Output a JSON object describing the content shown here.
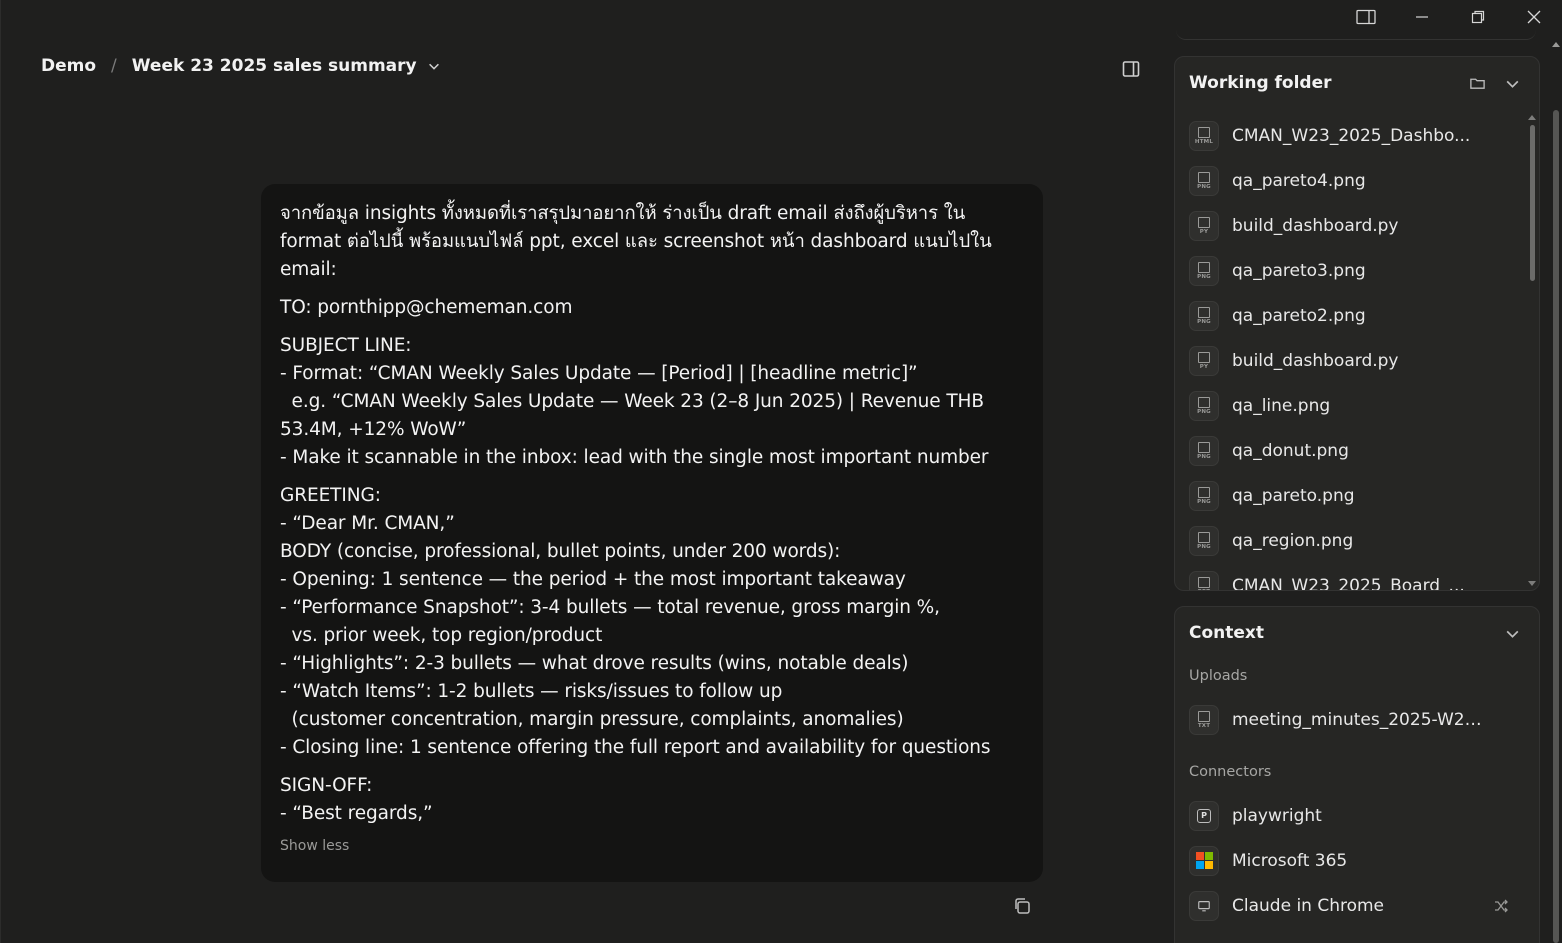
{
  "breadcrumb": {
    "root": "Demo",
    "separator": "/",
    "title": "Week 23 2025 sales summary"
  },
  "message": {
    "paragraphs": [
      [
        "จากข้อมูล insights ทั้งหมดที่เราสรุปมาอยากให้ ร่างเป็น draft email ส่งถึงผู้บริหาร ใน",
        "format ต่อไปนี้ พร้อมแนบไฟล์ ppt, excel และ screenshot หน้า dashboard แนบไปใน",
        "email:"
      ],
      [
        "TO: pornthipp@chememan.com"
      ],
      [
        "SUBJECT LINE:",
        "- Format: “CMAN Weekly Sales Update — [Period] | [headline metric]”",
        "  e.g. “CMAN Weekly Sales Update — Week 23 (2–8 Jun 2025) | Revenue THB",
        "53.4M, +12% WoW”",
        "- Make it scannable in the inbox: lead with the single most important number"
      ],
      [
        "GREETING:",
        "- “Dear Mr. CMAN,”",
        "BODY (concise, professional, bullet points, under 200 words):",
        "- Opening: 1 sentence — the period + the most important takeaway",
        "- “Performance Snapshot”: 3-4 bullets — total revenue, gross margin %,",
        "  vs. prior week, top region/product",
        "- “Highlights”: 2-3 bullets — what drove results (wins, notable deals)",
        "- “Watch Items”: 1-2 bullets — risks/issues to follow up",
        "  (customer concentration, margin pressure, complaints, anomalies)",
        "- Closing line: 1 sentence offering the full report and availability for questions"
      ],
      [
        "SIGN-OFF:",
        "- “Best regards,”"
      ]
    ],
    "show_less": "Show less"
  },
  "working_folder": {
    "title": "Working folder",
    "files": [
      {
        "name": "CMAN_W23_2025_Dashbo...",
        "ext": "HTML"
      },
      {
        "name": "qa_pareto4.png",
        "ext": "PNG"
      },
      {
        "name": "build_dashboard.py",
        "ext": "PY"
      },
      {
        "name": "qa_pareto3.png",
        "ext": "PNG"
      },
      {
        "name": "qa_pareto2.png",
        "ext": "PNG"
      },
      {
        "name": "build_dashboard.py",
        "ext": "PY"
      },
      {
        "name": "qa_line.png",
        "ext": "PNG"
      },
      {
        "name": "qa_donut.png",
        "ext": "PNG"
      },
      {
        "name": "qa_pareto.png",
        "ext": "PNG"
      },
      {
        "name": "qa_region.png",
        "ext": "PNG"
      },
      {
        "name": "CMAN_W23_2025_Board_...",
        "ext": "PPT"
      }
    ]
  },
  "context": {
    "title": "Context",
    "uploads_label": "Uploads",
    "uploads": [
      {
        "name": "meeting_minutes_2025-W23....",
        "ext": "TXT"
      }
    ],
    "connectors_label": "Connectors",
    "connectors": [
      {
        "name": "playwright",
        "badge": "P"
      },
      {
        "name": "Microsoft 365"
      },
      {
        "name": "Claude in Chrome"
      }
    ]
  },
  "colors": {
    "background": "#1f1f1e",
    "bubble": "#141413",
    "card": "#262624",
    "ms_red": "#f25022",
    "ms_green": "#7fba00",
    "ms_blue": "#00a4ef",
    "ms_yellow": "#ffb900"
  }
}
